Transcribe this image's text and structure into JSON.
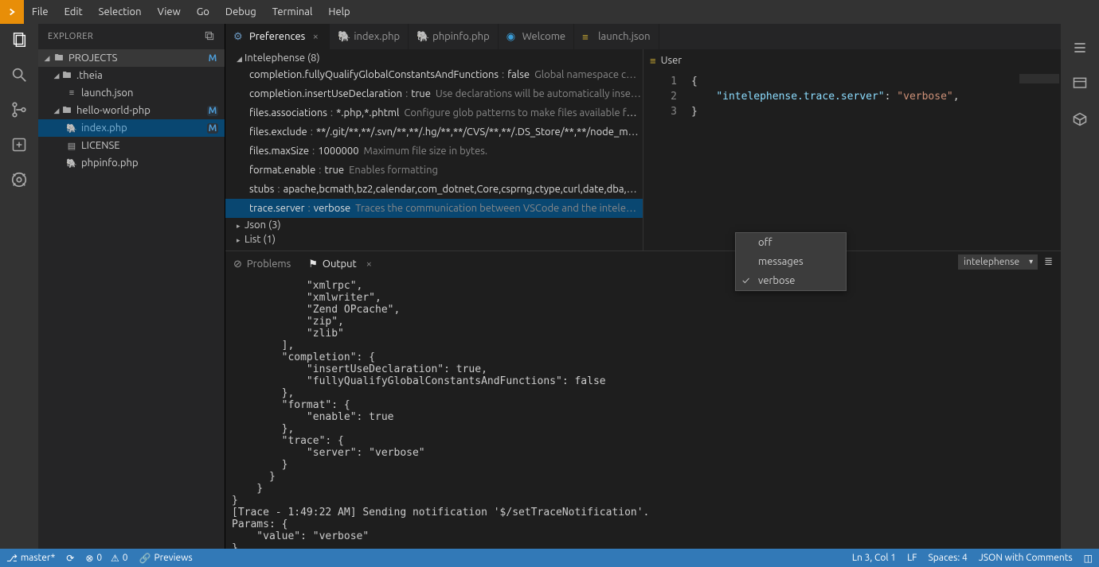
{
  "menu": [
    "File",
    "Edit",
    "Selection",
    "View",
    "Go",
    "Debug",
    "Terminal",
    "Help"
  ],
  "explorer": {
    "title": "EXPLORER",
    "projects_label": "PROJECTS",
    "tree": {
      "theia": ".theia",
      "launch": "launch.json",
      "hello": "hello-world-php",
      "index": "index.php",
      "license": "LICENSE",
      "phpinfo": "phpinfo.php"
    },
    "m_badge": "M"
  },
  "tabs": {
    "preferences": "Preferences",
    "index": "index.php",
    "phpinfo": "phpinfo.php",
    "welcome": "Welcome",
    "launch": "launch.json"
  },
  "prefs": {
    "section": "Intelephense (8)",
    "items": [
      {
        "k": "completion.fullyQualifyGlobalConstantsAndFunctions",
        "v": "false",
        "d": "Global namespace c…"
      },
      {
        "k": "completion.insertUseDeclaration",
        "v": "true",
        "d": "Use declarations will be automatically inse…"
      },
      {
        "k": "files.associations",
        "v": "*.php,*.phtml",
        "d": "Configure glob patterns to make files available fo…"
      },
      {
        "k": "files.exclude",
        "v": "**/.git/**,**/.svn/**,**/.hg/**,**/CVS/**,**/.DS_Store/**,**/node_modules/**",
        "d": ""
      },
      {
        "k": "files.maxSize",
        "v": "1000000",
        "d": "Maximum file size in bytes."
      },
      {
        "k": "format.enable",
        "v": "true",
        "d": "Enables formatting"
      },
      {
        "k": "stubs",
        "v": "apache,bcmath,bz2,calendar,com_dotnet,Core,csprng,ctype,curl,date,dba,dom",
        "d": ""
      },
      {
        "k": "trace.server",
        "v": "verbose",
        "d": "Traces the communication between VSCode and the intele…"
      }
    ],
    "json_section": "Json (3)",
    "list_section": "List (1)"
  },
  "right_tab": "User",
  "code": {
    "line1": "{",
    "line2_key": "\"intelephense.trace.server\"",
    "line2_val": "\"verbose\"",
    "line3": "}"
  },
  "dropdown": [
    "off",
    "messages",
    "verbose"
  ],
  "panel": {
    "problems": "Problems",
    "output": "Output",
    "channel": "intelephense"
  },
  "output_text": "            \"xmlrpc\",\n            \"xmlwriter\",\n            \"Zend OPcache\",\n            \"zip\",\n            \"zlib\"\n        ],\n        \"completion\": {\n            \"insertUseDeclaration\": true,\n            \"fullyQualifyGlobalConstantsAndFunctions\": false\n        },\n        \"format\": {\n            \"enable\": true\n        },\n        \"trace\": {\n            \"server\": \"verbose\"\n        }\n      }\n    }\n}\n[Trace - 1:49:22 AM] Sending notification '$/setTraceNotification'.\nParams: {\n    \"value\": \"verbose\"\n}",
  "status": {
    "branch": "master*",
    "err": "0",
    "warn": "0",
    "previews": "Previews",
    "ln": "Ln 3, Col 1",
    "lf": "LF",
    "spaces": "Spaces: 4",
    "lang": "JSON with Comments"
  }
}
